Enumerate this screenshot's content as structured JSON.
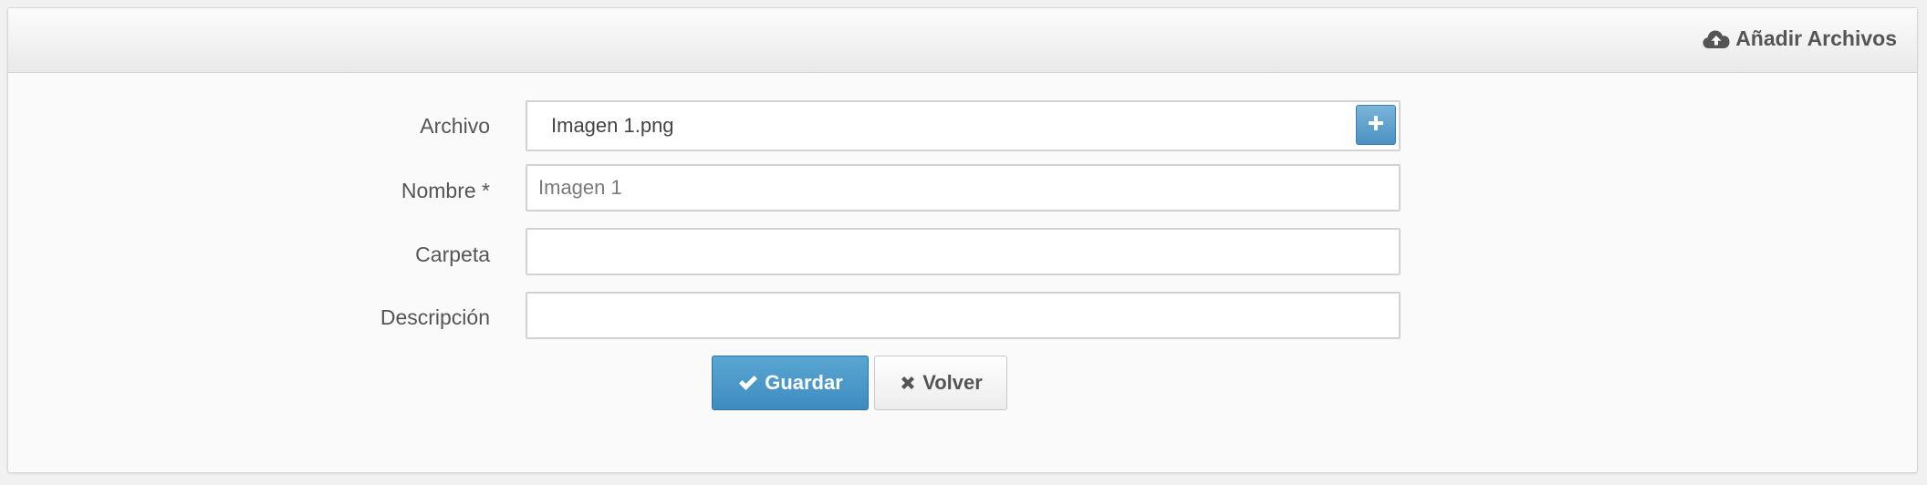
{
  "header": {
    "title": "Añadir Archivos",
    "icon": "cloud-upload-icon"
  },
  "form": {
    "archivo": {
      "label": "Archivo",
      "value": "Imagen 1.png",
      "add_icon": "plus-icon"
    },
    "nombre": {
      "label": "Nombre *",
      "value": "",
      "placeholder": "Imagen 1"
    },
    "carpeta": {
      "label": "Carpeta",
      "value": ""
    },
    "descripcion": {
      "label": "Descripción",
      "value": ""
    }
  },
  "actions": {
    "save_label": "Guardar",
    "save_icon": "check-icon",
    "back_label": "Volver",
    "back_icon": "x-icon"
  },
  "colors": {
    "primary": "#4a92c3",
    "text": "#555555",
    "panel_bg": "#fafafa"
  }
}
